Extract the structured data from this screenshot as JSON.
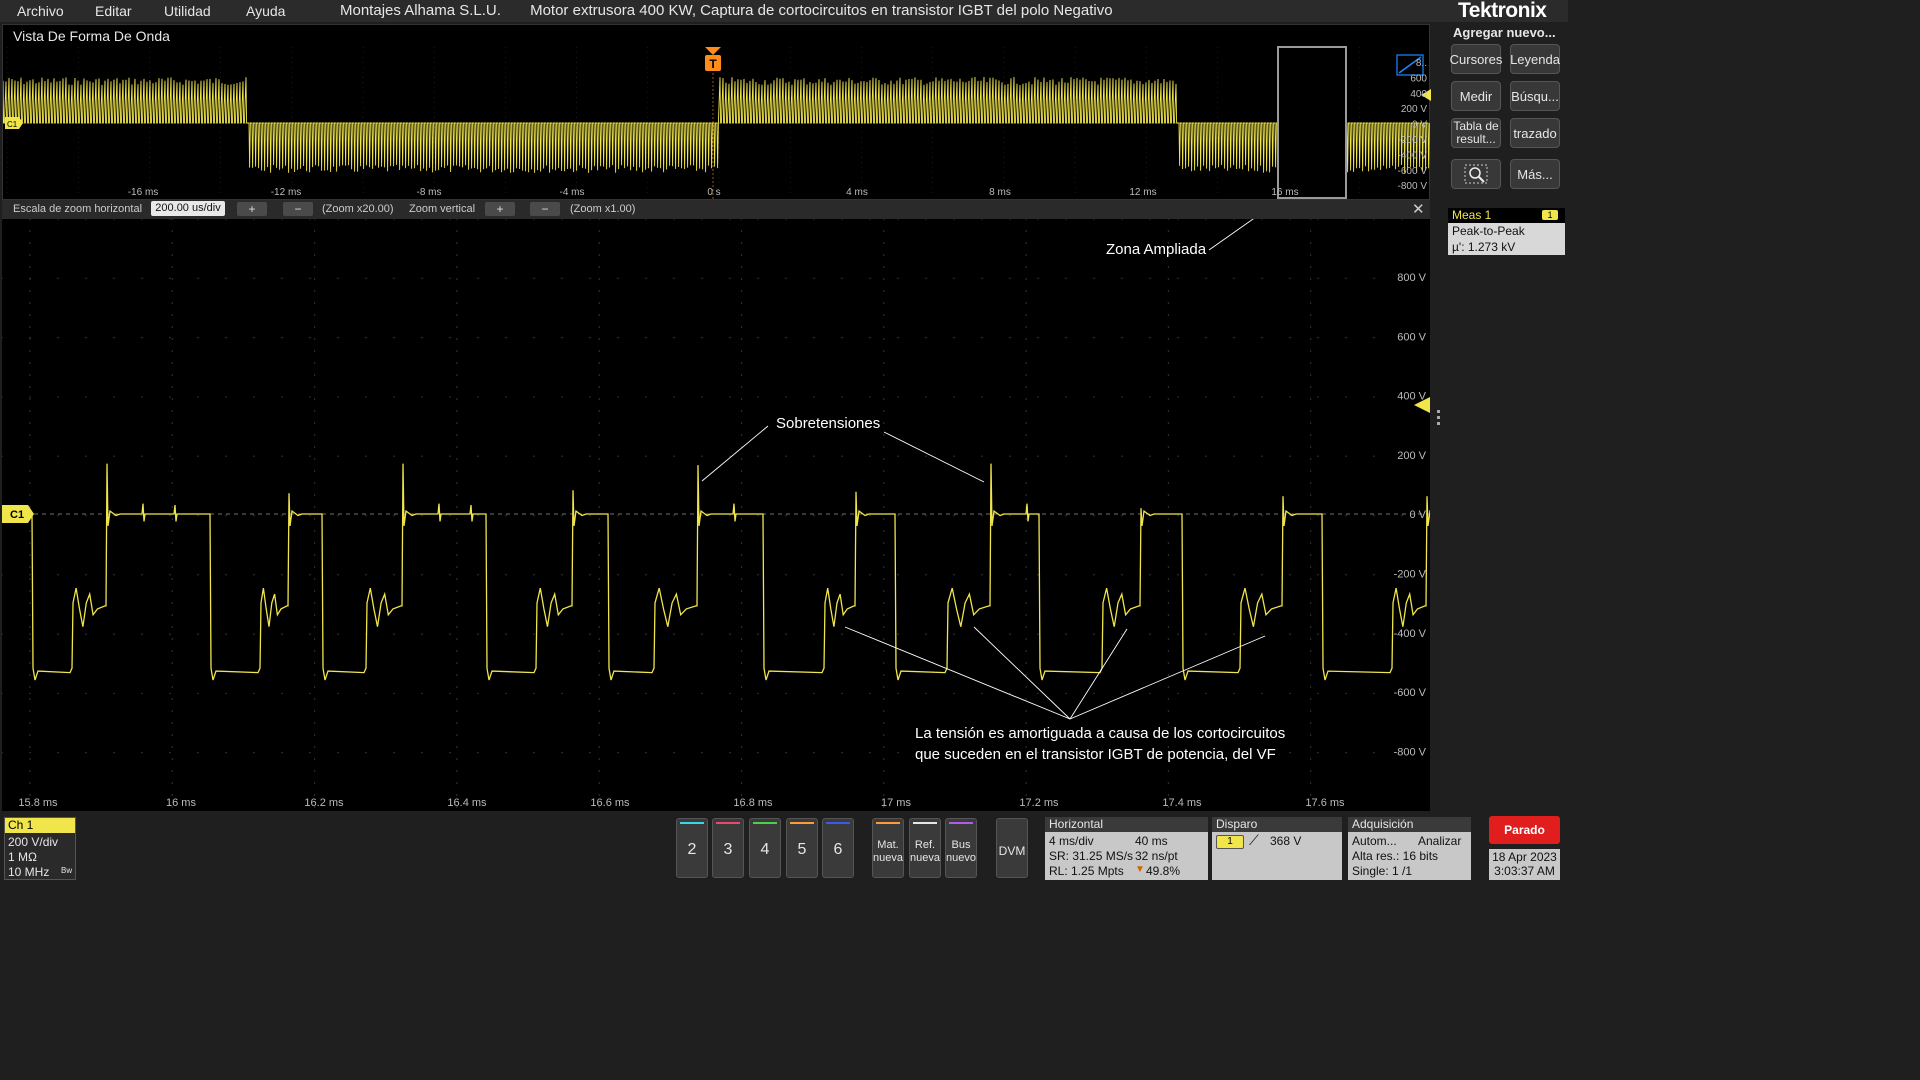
{
  "menu": [
    "Archivo",
    "Editar",
    "Utilidad",
    "Ayuda"
  ],
  "app_title": "Montajes Alhama S.L.U.       Motor extrusora 400 KW, Captura de cortocircuitos en transistor IGBT del polo Negativo",
  "logo": "Tektronix",
  "overview": {
    "title": "Vista De Forma De Onda",
    "channel_tag": "C1",
    "trigger_tag": "T",
    "time_ticks": [
      "-16 ms",
      "-12 ms",
      "-8 ms",
      "-4 ms",
      "0 s",
      "4 ms",
      "8 ms",
      "12 ms",
      "16 ms"
    ],
    "volt_ticks": [
      "8..",
      "600",
      "400",
      "200 V",
      "0 V",
      "-200 V",
      "-400 V",
      "-600 V",
      "-800 V"
    ]
  },
  "zoom_bar": {
    "h_label": "Escala de zoom horizontal",
    "h_value": "200.00 us/div",
    "h_factor": "(Zoom x20.00)",
    "v_label": "Zoom vertical",
    "v_factor": "(Zoom x1.00)",
    "plus": "+",
    "minus": "−",
    "close": "✕"
  },
  "main": {
    "channel_tag": "C1",
    "volt_ticks": [
      "800 V",
      "600 V",
      "400 V",
      "200 V",
      "0 V",
      "-200 V",
      "-400 V",
      "-600 V",
      "-800 V"
    ],
    "time_ticks": [
      "15.8 ms",
      "16 ms",
      "16.2 ms",
      "16.4 ms",
      "16.6 ms",
      "16.8 ms",
      "17 ms",
      "17.2 ms",
      "17.4 ms",
      "17.6 ms"
    ],
    "annotations": {
      "zona": "Zona Ampliada",
      "sobre": "Sobretensiones",
      "text1": "La tensión es amortiguada a causa de los cortocircuitos",
      "text2": "que suceden en el transistor IGBT de potencia, del VF"
    }
  },
  "right_panel": {
    "add_new": "Agregar nuevo...",
    "buttons": [
      "Cursores",
      "Leyenda",
      "Medir",
      "Búsqu...",
      "Tabla de result...",
      "trazado",
      "",
      "Más..."
    ],
    "meas": {
      "title": "Meas 1",
      "badge": "1",
      "name": "Peak-to-Peak",
      "value": "µ': 1.273 kV"
    }
  },
  "bottom": {
    "ch1": {
      "title": "Ch 1",
      "scale": "200 V/div",
      "impedance": "1 MΩ",
      "bandwidth": "10 MHz",
      "bw_tag": "Bw"
    },
    "channel_buttons": [
      "2",
      "3",
      "4",
      "5",
      "6"
    ],
    "math_buttons": [
      "Mat. nueva",
      "Ref. nueva",
      "Bus nuevo"
    ],
    "dvm": "DVM",
    "horizontal": {
      "title": "Horizontal",
      "scale": "4 ms/div",
      "position": "40 ms",
      "sr": "SR: 31.25 MS/s",
      "pt": "32 ns/pt",
      "rl": "RL: 1.25 Mpts",
      "pct": "49.8%"
    },
    "trigger": {
      "title": "Disparo",
      "channel": "1",
      "level": "368 V"
    },
    "acq": {
      "title": "Adquisición",
      "mode": "Autom...",
      "analyze": "Analizar",
      "res": "Alta res.: 16 bits",
      "single": "Single: 1 /1"
    },
    "run_state": "Parado",
    "date": "18 Apr 2023",
    "time": "3:03:37 AM"
  },
  "colors": {
    "trace": "#f0e54a",
    "trigger": "#ff8c1a",
    "stop": "#e01e1e"
  }
}
